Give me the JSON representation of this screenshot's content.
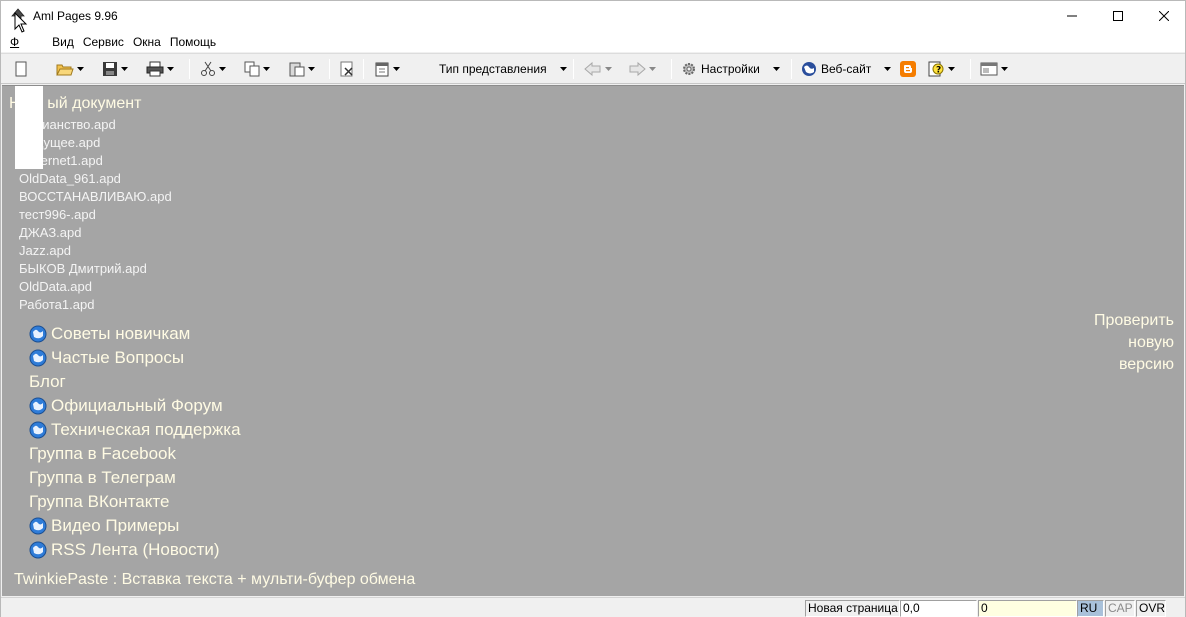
{
  "window": {
    "title": "Aml Pages 9.96",
    "controls": {
      "minimize": "minimize-icon",
      "maximize": "maximize-icon",
      "close": "close-icon"
    }
  },
  "menu": [
    {
      "label": "Файл",
      "visible": "Ф"
    },
    {
      "label": "Вид"
    },
    {
      "label": "Сервис"
    },
    {
      "label": "Окна"
    },
    {
      "label": "Помощь"
    }
  ],
  "toolbar": {
    "view_type_label": "Тип представления",
    "settings_label": "Настройки",
    "website_label": "Веб-сайт"
  },
  "main": {
    "doc_title": "Новый документ",
    "doc_title_visible": "Н      ый документ",
    "recent_files": [
      "Христианство.apd",
      "Будущее.apd",
      "Internet1.apd",
      "OldData_961.apd",
      "ВОССТАНАВЛИВАЮ.apd",
      "тест996-.apd",
      "ДЖАЗ.apd",
      "Jazz.apd",
      "БЫКОВ Дмитрий.apd",
      "OldData.apd",
      "Работа1.apd"
    ],
    "recent_files_visible": [
      "   стианство.apd",
      "   удущее.apd",
      "   nternet1.apd",
      "OldData_961.apd",
      "ВОССТАНАВЛИВАЮ.apd",
      "тест996-.apd",
      "ДЖАЗ.apd",
      "Jazz.apd",
      "БЫКОВ Дмитрий.apd",
      "OldData.apd",
      "Работа1.apd"
    ],
    "links": [
      {
        "label": "Советы новичкам",
        "icon": "globe-icon"
      },
      {
        "label": "Частые Вопросы",
        "icon": "globe-icon"
      },
      {
        "label": "Блог",
        "icon": null
      },
      {
        "label": "Официальный Форум",
        "icon": "globe-icon"
      },
      {
        "label": "Техническая поддержка",
        "icon": "globe-icon"
      },
      {
        "label": "Группа в Facebook",
        "icon": null
      },
      {
        "label": "Группа в Телеграм",
        "icon": null
      },
      {
        "label": "Группа ВКонтакте",
        "icon": null
      },
      {
        "label": "Видео Примеры",
        "icon": "globe-icon"
      },
      {
        "label": "RSS Лента (Новости)",
        "icon": "globe-icon"
      }
    ],
    "twinkie": "TwinkiePaste : Вставка текста + мульти-буфер обмена",
    "check_update": [
      "Проверить",
      "новую",
      "версию"
    ]
  },
  "statusbar": {
    "page": "Новая страница",
    "position": "0,0",
    "count": "0",
    "lang": "RU",
    "cap": "CAP",
    "ovr": "OVR"
  },
  "colors": {
    "main_bg": "#a5a5a5",
    "link_text": "#fffbe4",
    "lang_bg": "#a9c1da"
  }
}
